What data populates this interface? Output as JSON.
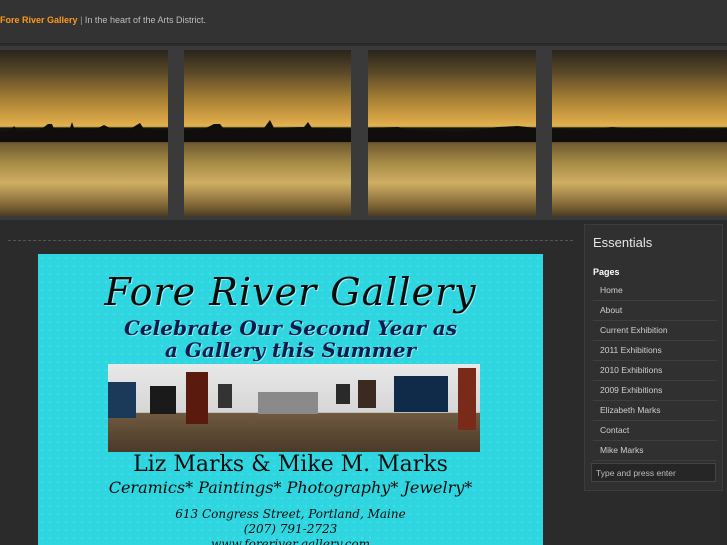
{
  "header": {
    "site_title": "Fore River Gallery",
    "separator": "|",
    "tagline": "In the heart of the Arts District."
  },
  "poster": {
    "title": "Fore River Gallery",
    "subtitle_line1": "Celebrate Our Second Year as",
    "subtitle_line2": "a Gallery this Summer",
    "artists": "Liz Marks & Mike M. Marks",
    "media": "Ceramics* Paintings* Photography* Jewelry*",
    "address_line1": "613 Congress Street, Portland, Maine",
    "phone": "(207) 791-2723",
    "website": "www.foreriver.gallery.com"
  },
  "sidebar": {
    "title": "Essentials",
    "pages_heading": "Pages",
    "items": [
      {
        "label": "Home"
      },
      {
        "label": "About"
      },
      {
        "label": "Current Exhibition"
      },
      {
        "label": "2011 Exhibitions"
      },
      {
        "label": "2010 Exhibitions"
      },
      {
        "label": "2009 Exhibitions"
      },
      {
        "label": "Elizabeth Marks"
      },
      {
        "label": "Contact"
      },
      {
        "label": "Mike Marks"
      }
    ],
    "search_placeholder": "Type and press enter"
  },
  "colors": {
    "accent": "#ff9a1a",
    "background": "#2b2b2b",
    "poster_background": "#2fd6e0"
  }
}
